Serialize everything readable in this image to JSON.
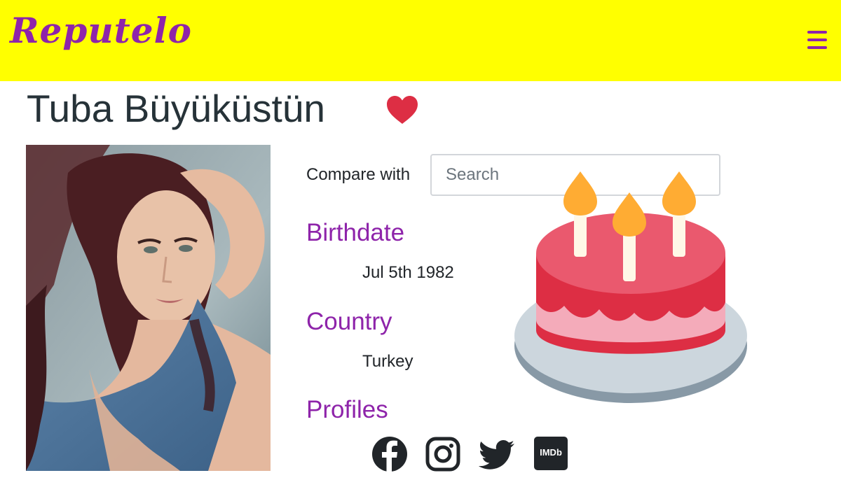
{
  "brand": "Reputelo",
  "profile": {
    "name": "Tuba Büyüküstün",
    "compare_label": "Compare with",
    "search_placeholder": "Search",
    "birthdate_title": "Birthdate",
    "birthdate_value": "Jul 5th 1982",
    "country_title": "Country",
    "country_value": "Turkey",
    "profiles_title": "Profiles"
  },
  "icons": {
    "menu": "hamburger-menu-icon",
    "favorite": "heart-icon",
    "birthday": "birthday-cake-icon",
    "social": [
      "facebook-icon",
      "instagram-icon",
      "twitter-icon",
      "imdb-icon"
    ]
  },
  "social": {
    "imdb_label": "IMDb"
  },
  "colors": {
    "navbar_bg": "#ffff00",
    "accent": "#8e24aa",
    "heart": "#dd2e44",
    "title": "#263238"
  }
}
